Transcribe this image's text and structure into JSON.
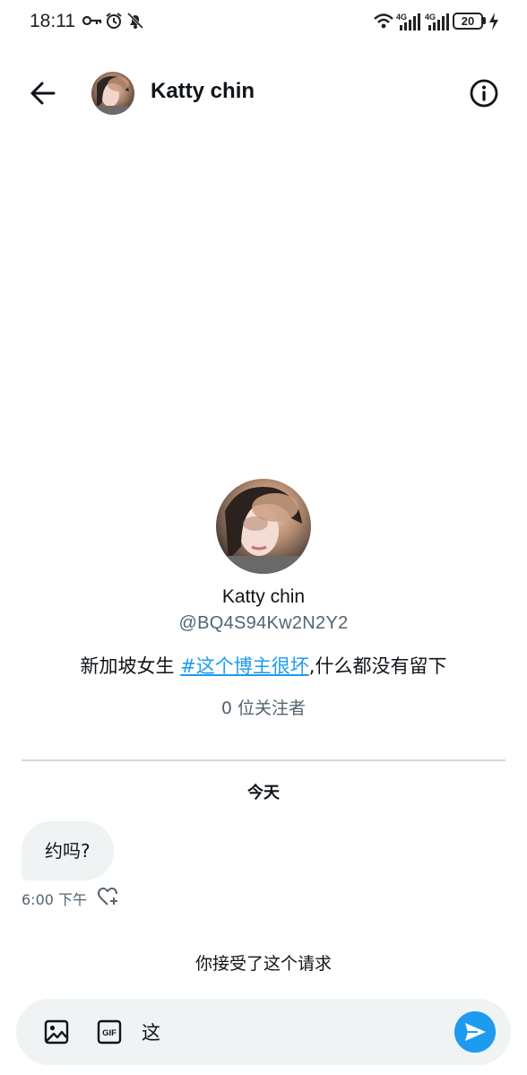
{
  "status_bar": {
    "time": "18:11",
    "battery": "20",
    "icons": [
      "key-icon",
      "alarm-icon",
      "bell-mute-icon",
      "wifi-icon",
      "signal-4g-icon",
      "signal-4g-icon",
      "battery-icon",
      "charging-icon"
    ],
    "network": [
      "4G",
      "4G"
    ]
  },
  "header": {
    "title": "Katty chin",
    "icons": [
      "back-arrow-icon",
      "info-icon"
    ]
  },
  "profile": {
    "name": "Katty chin",
    "handle": "@BQ4S94Kw2N2Y2",
    "bio_before": "新加坡女生 ",
    "bio_hashtag": "#这个博主很坏",
    "bio_after": ",什么都没有留下",
    "followers": "0 位关注者"
  },
  "conversation": {
    "date_label": "今天",
    "messages": [
      {
        "text": "约吗?",
        "time": "6:00 下午"
      }
    ],
    "request_notice": "你接受了这个请求"
  },
  "composer": {
    "value": "这",
    "icons": [
      "image-icon",
      "gif-icon",
      "send-icon"
    ],
    "gif_label": "GIF"
  },
  "colors": {
    "accent": "#1d9bf0",
    "text_primary": "#0f1419",
    "text_secondary": "#536471",
    "bubble_bg": "#eff3f4"
  }
}
